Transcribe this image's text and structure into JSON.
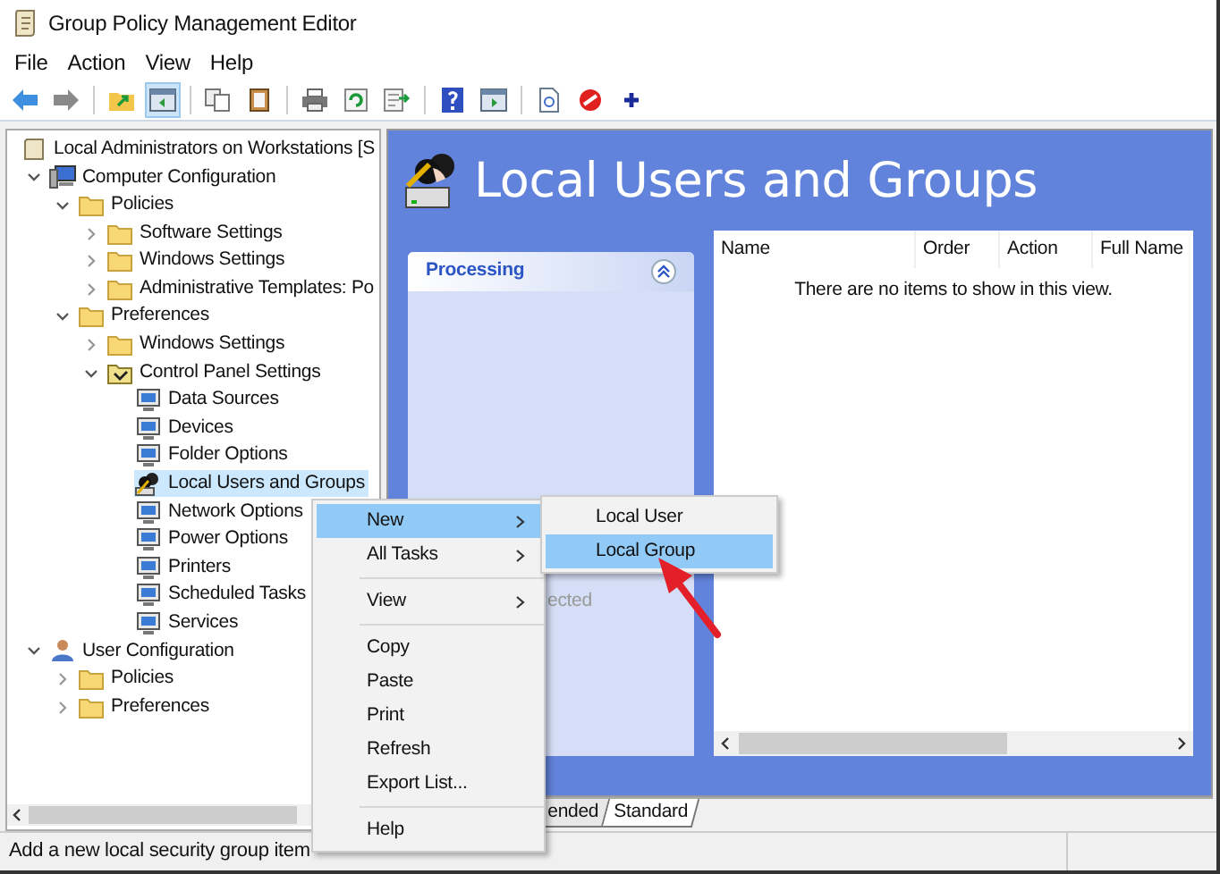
{
  "window": {
    "title": "Group Policy Management Editor"
  },
  "menu_bar": [
    "File",
    "Action",
    "View",
    "Help"
  ],
  "toolbar": [
    {
      "kind": "back",
      "pressed": false
    },
    {
      "kind": "forward",
      "pressed": false
    },
    {
      "kind": "sep"
    },
    {
      "kind": "up",
      "pressed": false
    },
    {
      "kind": "tree",
      "pressed": true
    },
    {
      "kind": "sep"
    },
    {
      "kind": "copy",
      "pressed": false
    },
    {
      "kind": "paste",
      "pressed": false
    },
    {
      "kind": "sep"
    },
    {
      "kind": "print",
      "pressed": false
    },
    {
      "kind": "refresh",
      "pressed": false
    },
    {
      "kind": "export",
      "pressed": false
    },
    {
      "kind": "sep"
    },
    {
      "kind": "help",
      "pressed": false
    },
    {
      "kind": "pane",
      "pressed": false
    },
    {
      "kind": "sep"
    },
    {
      "kind": "doc",
      "pressed": false
    },
    {
      "kind": "stop",
      "pressed": false
    },
    {
      "kind": "plus",
      "pressed": false
    }
  ],
  "tree": {
    "root": {
      "label": "Local Administrators on Workstations [S",
      "selected": false
    },
    "items": [
      {
        "label": "Computer Configuration",
        "kind": "computer",
        "expanded": true,
        "selected": false,
        "children": [
          {
            "label": "Policies",
            "kind": "folder",
            "expanded": true,
            "selected": false,
            "children": [
              {
                "label": "Software Settings",
                "kind": "folder",
                "expanded": false,
                "selected": false
              },
              {
                "label": "Windows Settings",
                "kind": "folder",
                "expanded": false,
                "selected": false
              },
              {
                "label": "Administrative Templates: Po",
                "kind": "folder",
                "expanded": false,
                "selected": false
              }
            ]
          },
          {
            "label": "Preferences",
            "kind": "folder",
            "expanded": true,
            "selected": false,
            "children": [
              {
                "label": "Windows Settings",
                "kind": "folder",
                "expanded": false,
                "selected": false
              },
              {
                "label": "Control Panel Settings",
                "kind": "panel",
                "expanded": true,
                "selected": false,
                "children": [
                  {
                    "label": "Data Sources",
                    "kind": "item",
                    "selected": false
                  },
                  {
                    "label": "Devices",
                    "kind": "item",
                    "selected": false
                  },
                  {
                    "label": "Folder Options",
                    "kind": "item",
                    "selected": false
                  },
                  {
                    "label": "Local Users and Groups",
                    "kind": "users",
                    "selected": true
                  },
                  {
                    "label": "Network Options",
                    "kind": "item",
                    "selected": false
                  },
                  {
                    "label": "Power Options",
                    "kind": "item",
                    "selected": false
                  },
                  {
                    "label": "Printers",
                    "kind": "item",
                    "selected": false
                  },
                  {
                    "label": "Scheduled Tasks",
                    "kind": "item",
                    "selected": false
                  },
                  {
                    "label": "Services",
                    "kind": "item",
                    "selected": false
                  }
                ]
              }
            ]
          }
        ]
      },
      {
        "label": "User Configuration",
        "kind": "user",
        "expanded": true,
        "selected": false,
        "children": [
          {
            "label": "Policies",
            "kind": "folder",
            "expanded": false,
            "selected": false
          },
          {
            "label": "Preferences",
            "kind": "folder",
            "expanded": false,
            "selected": false
          }
        ]
      }
    ]
  },
  "details": {
    "title": "Local Users and Groups",
    "processing": {
      "title": "Processing",
      "expanded": true,
      "text": "ected"
    },
    "table": {
      "columns": [
        "Name",
        "Order",
        "Action",
        "Full Name"
      ],
      "empty_message": "There are no items to show in this view."
    },
    "tabs": [
      {
        "label": "ended",
        "selected": false
      },
      {
        "label": "Standard",
        "selected": true
      }
    ]
  },
  "context_menu": {
    "groups": [
      [
        {
          "label": "New",
          "submenu": true,
          "selected": true
        },
        {
          "label": "All Tasks",
          "submenu": true,
          "selected": false
        }
      ],
      [
        {
          "label": "View",
          "submenu": true,
          "selected": false
        }
      ],
      [
        {
          "label": "Copy",
          "submenu": false,
          "selected": false
        },
        {
          "label": "Paste",
          "submenu": false,
          "selected": false
        },
        {
          "label": "Print",
          "submenu": false,
          "selected": false
        },
        {
          "label": "Refresh",
          "submenu": false,
          "selected": false
        },
        {
          "label": "Export List...",
          "submenu": false,
          "selected": false
        }
      ],
      [
        {
          "label": "Help",
          "submenu": false,
          "selected": false
        }
      ]
    ]
  },
  "submenu": [
    {
      "label": "Local User",
      "selected": false
    },
    {
      "label": "Local Group",
      "selected": true
    }
  ],
  "status_bar": "Add a new local security group item"
}
